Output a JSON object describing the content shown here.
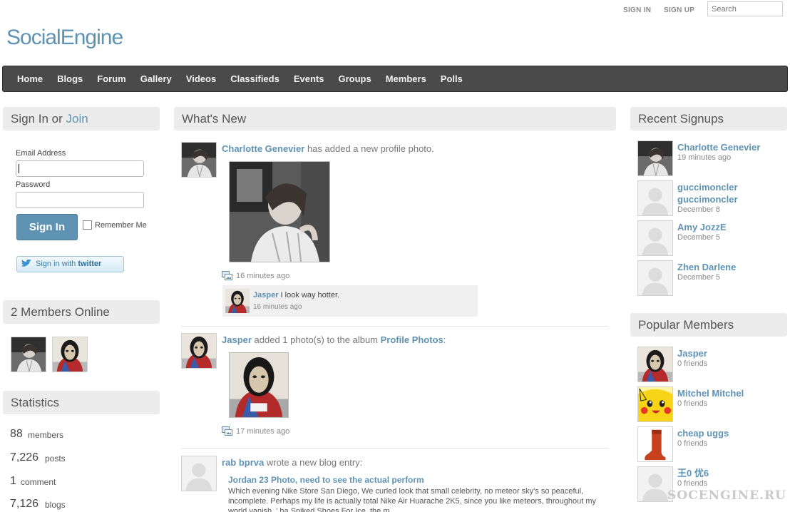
{
  "header": {
    "sign_in": "SIGN IN",
    "sign_up": "SIGN UP",
    "search_placeholder": "Search",
    "logo": "SocialEngine"
  },
  "nav": [
    "Home",
    "Blogs",
    "Forum",
    "Gallery",
    "Videos",
    "Classifieds",
    "Events",
    "Groups",
    "Members",
    "Polls"
  ],
  "signin": {
    "title_prefix": "Sign In or",
    "title_link": "Join",
    "email_label": "Email Address",
    "password_label": "Password",
    "button": "Sign In",
    "remember": "Remember Me",
    "twitter_prefix": "Sign in with",
    "twitter_brand": "twitter"
  },
  "online": {
    "title": "2 Members Online"
  },
  "statistics": {
    "title": "Statistics",
    "rows": [
      {
        "num": "88",
        "label": "members"
      },
      {
        "num": "7,226",
        "label": "posts"
      },
      {
        "num": "1",
        "label": "comment"
      },
      {
        "num": "7,126",
        "label": "blogs"
      }
    ]
  },
  "feed": {
    "title": "What's New",
    "items": [
      {
        "name": "Charlotte Genevier",
        "action": "has added a new profile photo.",
        "time": "16 minutes ago"
      },
      {
        "name": "Jasper",
        "action": "added 1 photo(s) to the album",
        "album": "Profile Photos",
        "tail": ":",
        "time": "17 minutes ago"
      },
      {
        "name": "rab bprva",
        "action": "wrote a new blog entry:"
      }
    ],
    "comment": {
      "name": "Jasper",
      "text": "I look way hotter.",
      "time": "16 minutes ago"
    },
    "blog": {
      "title": "Jordan 23 Photo, need to see the actual perform",
      "body": "Which evening Nike Store San Diego, We curled look that small celebrity, no meteor sky's so peaceful, incomplete. Perhaps my life is actually total Nike Air Huarache 2K5, since you like meteors, throughout my world vanish, ' ha Spiked Shoes For Ice, the m"
    }
  },
  "recent_signups": {
    "title": "Recent Signups",
    "members": [
      {
        "name": "Charlotte Genevier",
        "sub": "19 minutes ago"
      },
      {
        "name": "guccimoncler guccimoncler",
        "sub": "December 8"
      },
      {
        "name": "Amy JozzE",
        "sub": "December 5"
      },
      {
        "name": "Zhen Darlene",
        "sub": "December 5"
      }
    ]
  },
  "popular_members": {
    "title": "Popular Members",
    "members": [
      {
        "name": "Jasper",
        "sub": "0 friends"
      },
      {
        "name": "Mitchel Mitchel",
        "sub": "0 friends"
      },
      {
        "name": "cheap uggs",
        "sub": "0 friends"
      },
      {
        "name": "王0 优6",
        "sub": "0 friends"
      }
    ]
  },
  "watermark": "SOCENGINE.RU",
  "colors": {
    "accent": "#5f93b4",
    "nav_bg": "#4a4a4a",
    "panel_bg": "#ececec"
  }
}
